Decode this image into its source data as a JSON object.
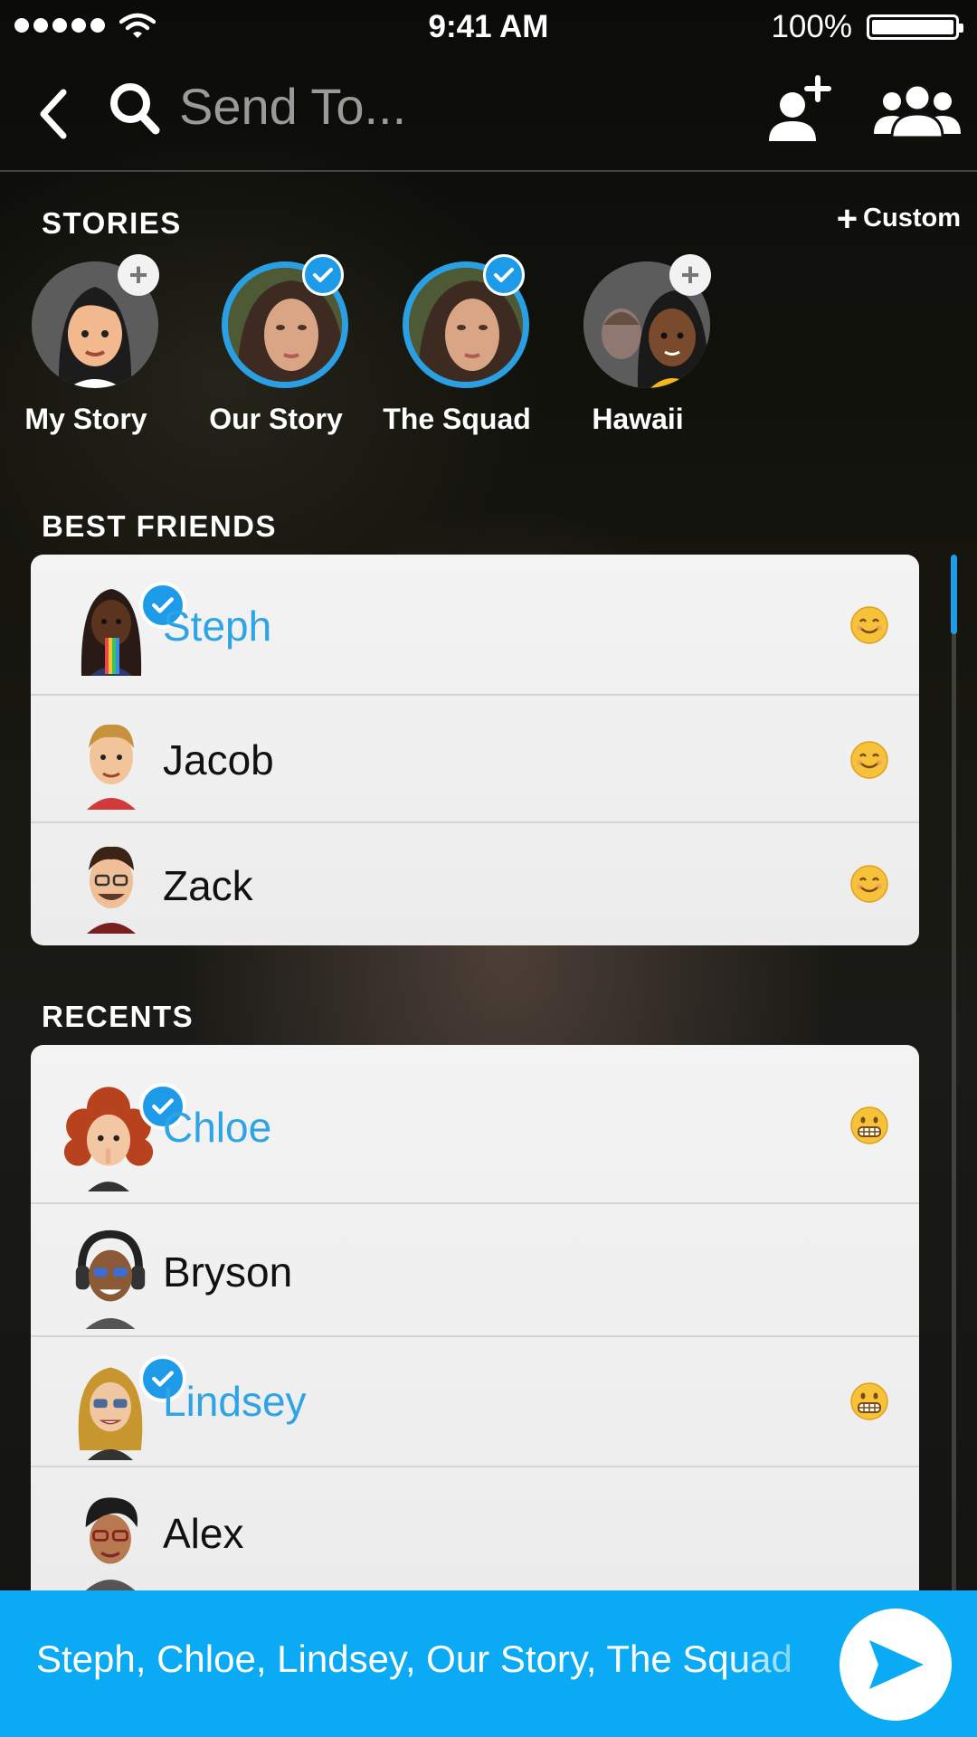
{
  "status_bar": {
    "time": "9:41 AM",
    "battery": "100%"
  },
  "header": {
    "search_placeholder": "Send To..."
  },
  "stories": {
    "title": "STORIES",
    "custom_label": "Custom",
    "items": [
      {
        "label": "My Story",
        "state": "add"
      },
      {
        "label": "Our Story",
        "state": "selected"
      },
      {
        "label": "The Squad",
        "state": "selected"
      },
      {
        "label": "Hawaii",
        "state": "add"
      }
    ]
  },
  "best_friends": {
    "title": "BEST FRIENDS",
    "items": [
      {
        "name": "Steph",
        "selected": true,
        "emoji": "smile"
      },
      {
        "name": "Jacob",
        "selected": false,
        "emoji": "smile"
      },
      {
        "name": "Zack",
        "selected": false,
        "emoji": "smile"
      }
    ]
  },
  "recents": {
    "title": "RECENTS",
    "items": [
      {
        "name": "Chloe",
        "selected": true,
        "emoji": "grimace"
      },
      {
        "name": "Bryson",
        "selected": false,
        "emoji": ""
      },
      {
        "name": "Lindsey",
        "selected": true,
        "emoji": "grimace"
      },
      {
        "name": "Alex",
        "selected": false,
        "emoji": ""
      }
    ]
  },
  "send_bar": {
    "recipients": "Steph, Chloe, Lindsey, Our Story, The Squad"
  },
  "colors": {
    "accent": "#1e9be8",
    "send_bar": "#0aaaf4",
    "selected_text": "#2ea4e6"
  }
}
